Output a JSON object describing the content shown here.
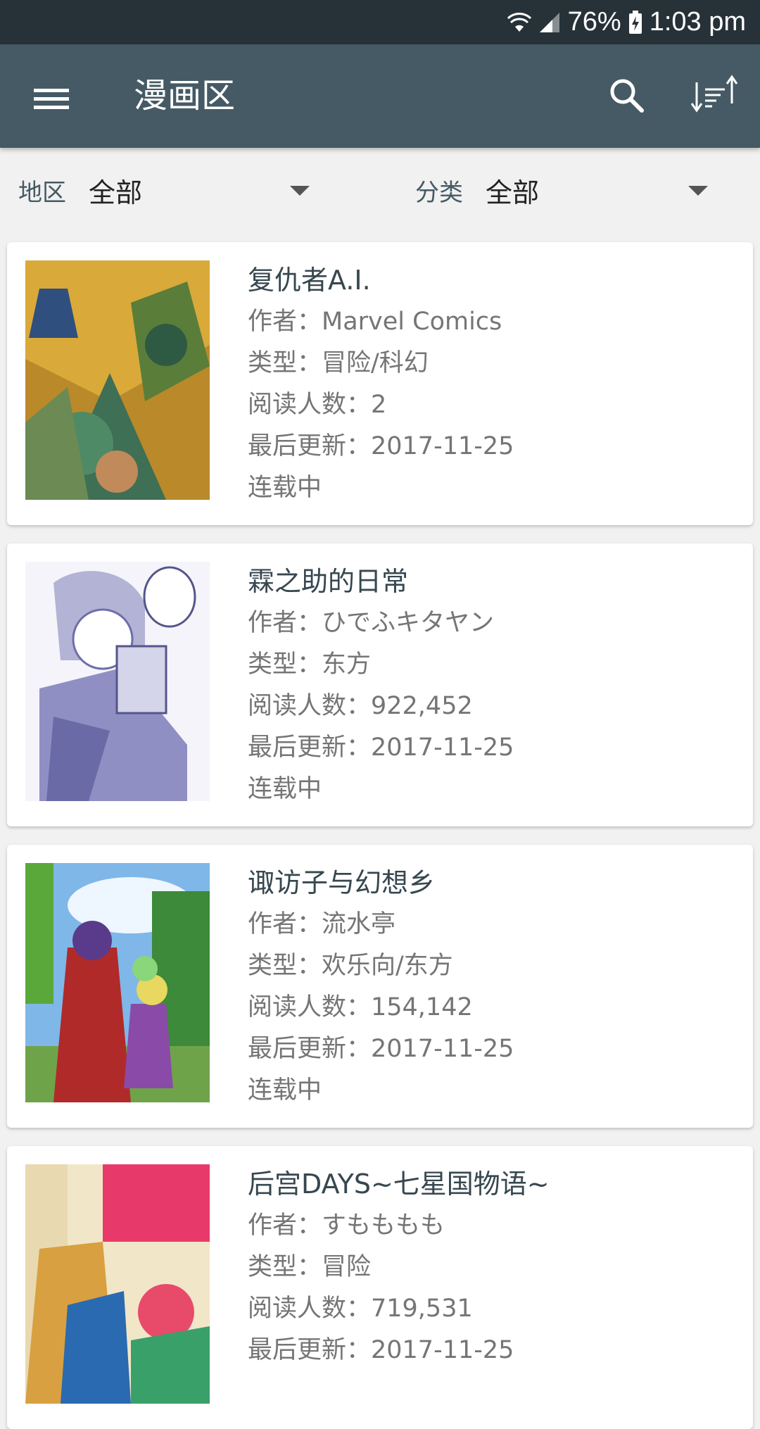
{
  "status_bar": {
    "battery": "76%",
    "time": "1:03 pm",
    "icons": [
      "wifi-icon",
      "cell-signal-icon",
      "battery-charging-icon"
    ]
  },
  "toolbar": {
    "title": "漫画区",
    "icons": [
      "menu-icon",
      "search-icon",
      "sort-icon"
    ]
  },
  "filters": {
    "region": {
      "label": "地区",
      "value": "全部"
    },
    "category": {
      "label": "分类",
      "value": "全部"
    }
  },
  "comics": [
    {
      "title": "复仇者A.I.",
      "author": "作者：Marvel Comics",
      "genre": "类型：冒险/科幻",
      "readers": "阅读人数：2",
      "updated": "最后更新：2017-11-25",
      "status": "连载中"
    },
    {
      "title": "霖之助的日常",
      "author": "作者：ひでふキタヤン",
      "genre": "类型：东方",
      "readers": "阅读人数：922,452",
      "updated": "最后更新：2017-11-25",
      "status": "连载中"
    },
    {
      "title": "诹访子与幻想乡",
      "author": "作者：流水亭",
      "genre": "类型：欢乐向/东方",
      "readers": "阅读人数：154,142",
      "updated": "最后更新：2017-11-25",
      "status": "连载中"
    },
    {
      "title": "后宫DAYS~七星国物语~",
      "author": "作者：すもももも",
      "genre": "类型：冒险",
      "readers": "阅读人数：719,531",
      "updated": "最后更新：2017-11-25",
      "status": ""
    }
  ],
  "colors": {
    "status_bar": "#263238",
    "toolbar": "#455a64",
    "background": "#f1f1f1",
    "card": "#ffffff",
    "title_text": "#37474f",
    "meta_text": "#757575"
  }
}
